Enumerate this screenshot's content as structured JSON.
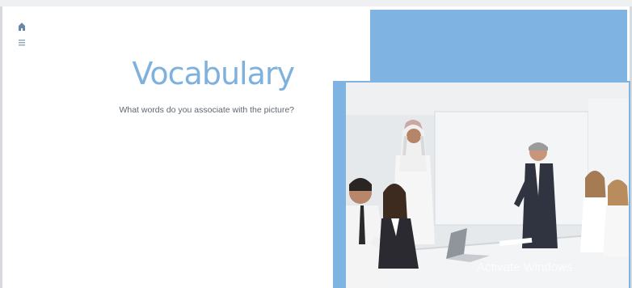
{
  "slide": {
    "title": "Vocabulary",
    "subtitle": "What words do you associate with the picture?",
    "image_alt": "Business meeting in a conference room",
    "watermark": "Activate Windows"
  },
  "icons": {
    "home": "home-icon",
    "menu": "menu-icon"
  },
  "colors": {
    "accent": "#7fb3e1",
    "title": "#7fb1de",
    "text": "#5f6770"
  }
}
